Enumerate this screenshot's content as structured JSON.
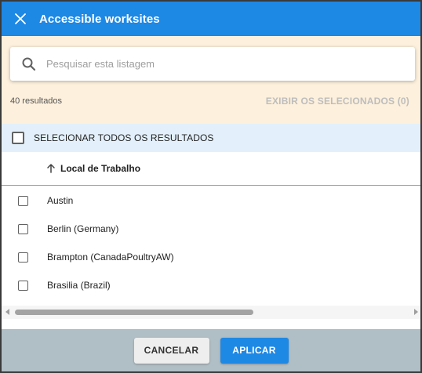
{
  "header": {
    "title": "Accessible worksites",
    "close_icon": "close-icon"
  },
  "search": {
    "placeholder": "Pesquisar esta listagem",
    "value": "",
    "icon": "search-icon"
  },
  "results": {
    "count_label": "40 resultados",
    "show_selected_label": "EXIBIR OS SELECIONADOS (0)"
  },
  "select_all": {
    "label": "SELECIONAR TODOS OS RESULTADOS",
    "checked": false
  },
  "column": {
    "label": "Local de Trabalho",
    "sort_icon": "arrow-up-icon"
  },
  "rows": [
    {
      "label": "Austin",
      "checked": false
    },
    {
      "label": "Berlin (Germany)",
      "checked": false
    },
    {
      "label": "Brampton (CanadaPoultryAW)",
      "checked": false
    },
    {
      "label": "Brasilia (Brazil)",
      "checked": false
    }
  ],
  "footer": {
    "cancel_label": "CANCELAR",
    "apply_label": "APLICAR"
  },
  "colors": {
    "header_bg": "#1e88e5",
    "filter_bg": "#fdf0dc",
    "select_all_bg": "#e3f0fb",
    "footer_bg": "#b0bec5",
    "apply_bg": "#1e88e5"
  }
}
